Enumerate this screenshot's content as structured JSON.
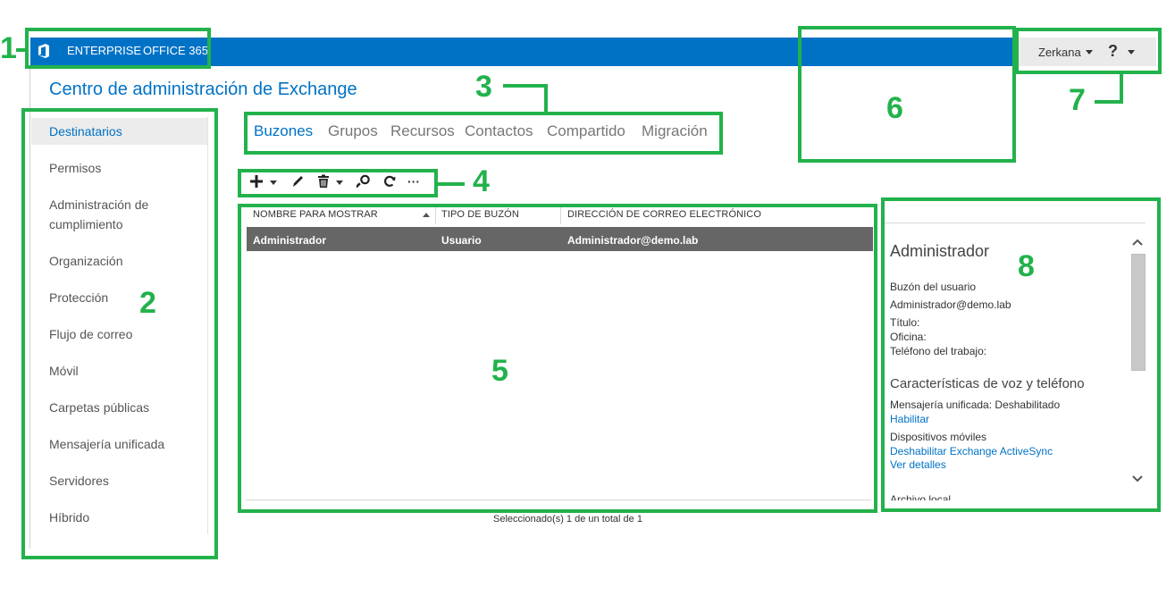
{
  "topbar": {
    "brand_icon": "office-logo-icon",
    "nav": [
      "ENTERPRISE",
      "OFFICE 365"
    ],
    "user": "Zerkana",
    "help": "?"
  },
  "app_title": "Centro de administración de Exchange",
  "sidebar": {
    "items": [
      {
        "label": "Destinatarios",
        "selected": true
      },
      {
        "label": "Permisos"
      },
      {
        "label": "Administración de cumplimiento"
      },
      {
        "label": "Organización"
      },
      {
        "label": "Protección"
      },
      {
        "label": "Flujo de correo"
      },
      {
        "label": "Móvil"
      },
      {
        "label": "Carpetas públicas"
      },
      {
        "label": "Mensajería unificada"
      },
      {
        "label": "Servidores"
      },
      {
        "label": "Híbrido"
      }
    ]
  },
  "tabs": [
    {
      "label": "Buzones",
      "selected": true
    },
    {
      "label": "Grupos"
    },
    {
      "label": "Recursos"
    },
    {
      "label": "Contactos"
    },
    {
      "label": "Compartido"
    },
    {
      "label": "Migración"
    }
  ],
  "toolbar": {
    "icons": [
      "add-icon",
      "edit-icon",
      "delete-icon",
      "search-icon",
      "refresh-icon",
      "more-icon"
    ],
    "more_label": "···"
  },
  "grid": {
    "columns": [
      "NOMBRE PARA MOSTRAR",
      "TIPO DE BUZÓN",
      "DIRECCIÓN DE CORREO ELECTRÓNICO"
    ],
    "rows": [
      {
        "name": "Administrador",
        "type": "Usuario",
        "email": "Administrador@demo.lab",
        "selected": true
      }
    ],
    "status": "Seleccionado(s) 1 de un total de 1"
  },
  "details": {
    "name": "Administrador",
    "mailbox_type": "Buzón del usuario",
    "email": "Administrador@demo.lab",
    "title_label": "Título:",
    "office_label": "Oficina:",
    "phone_label": "Teléfono del trabajo:",
    "voice_header": "Características de voz y teléfono",
    "um_status": "Mensajería unificada: Deshabilitado",
    "enable_link": "Habilitar",
    "mobile_label": "Dispositivos móviles",
    "disable_activesync_link": "Deshabilitar Exchange ActiveSync",
    "view_details_link": "Ver detalles",
    "clipped_text": "Archivo local"
  },
  "annotations": [
    "1",
    "2",
    "3",
    "4",
    "5",
    "6",
    "7",
    "8"
  ],
  "colors": {
    "brand_blue": "#0072c6",
    "annotation_green": "#22b24c",
    "selected_row": "#666666"
  }
}
